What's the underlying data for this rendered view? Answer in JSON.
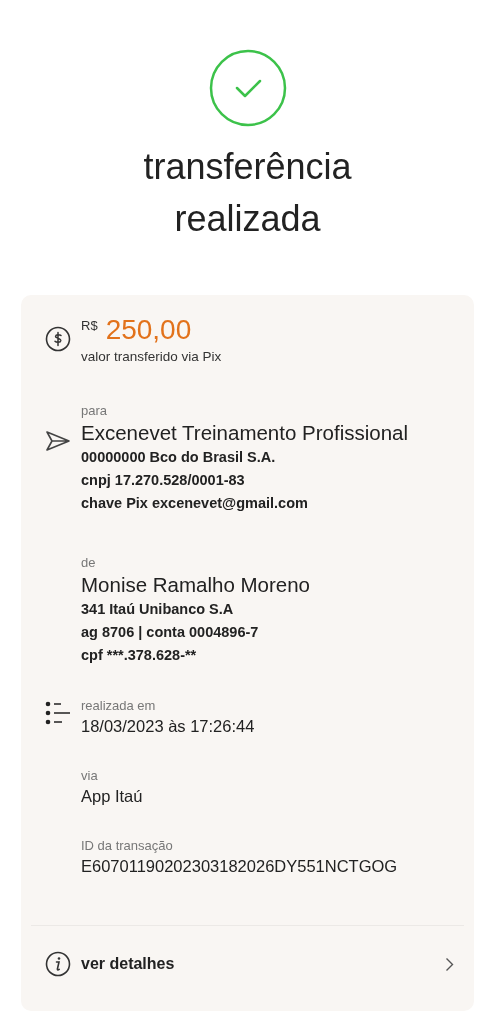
{
  "status": {
    "title": "transferência realizada"
  },
  "amount": {
    "currency": "R$",
    "value": "250,00",
    "caption": "valor transferido via Pix"
  },
  "sections": [
    {
      "kind": "party",
      "label": "para",
      "name": "Excenevet Treinamento Profissional",
      "lines": [
        "00000000 Bco do Brasil S.A.",
        "cnpj 17.270.528/0001-83",
        "chave Pix excenevet@gmail.com"
      ]
    },
    {
      "kind": "party",
      "label": "de",
      "name": "Monise Ramalho Moreno",
      "lines": [
        "341 Itaú Unibanco S.A",
        "ag 8706 | conta 0004896-7",
        "cpf ***.378.628-**"
      ]
    },
    {
      "kind": "info",
      "label": "realizada em",
      "value": "18/03/2023 às 17:26:44"
    },
    {
      "kind": "info",
      "label": "via",
      "value": "App Itaú"
    },
    {
      "kind": "info",
      "label": "ID da transação",
      "value": "E60701190202303182026DY551NCTGOG"
    }
  ],
  "details_link": {
    "label": "ver detalhes"
  }
}
